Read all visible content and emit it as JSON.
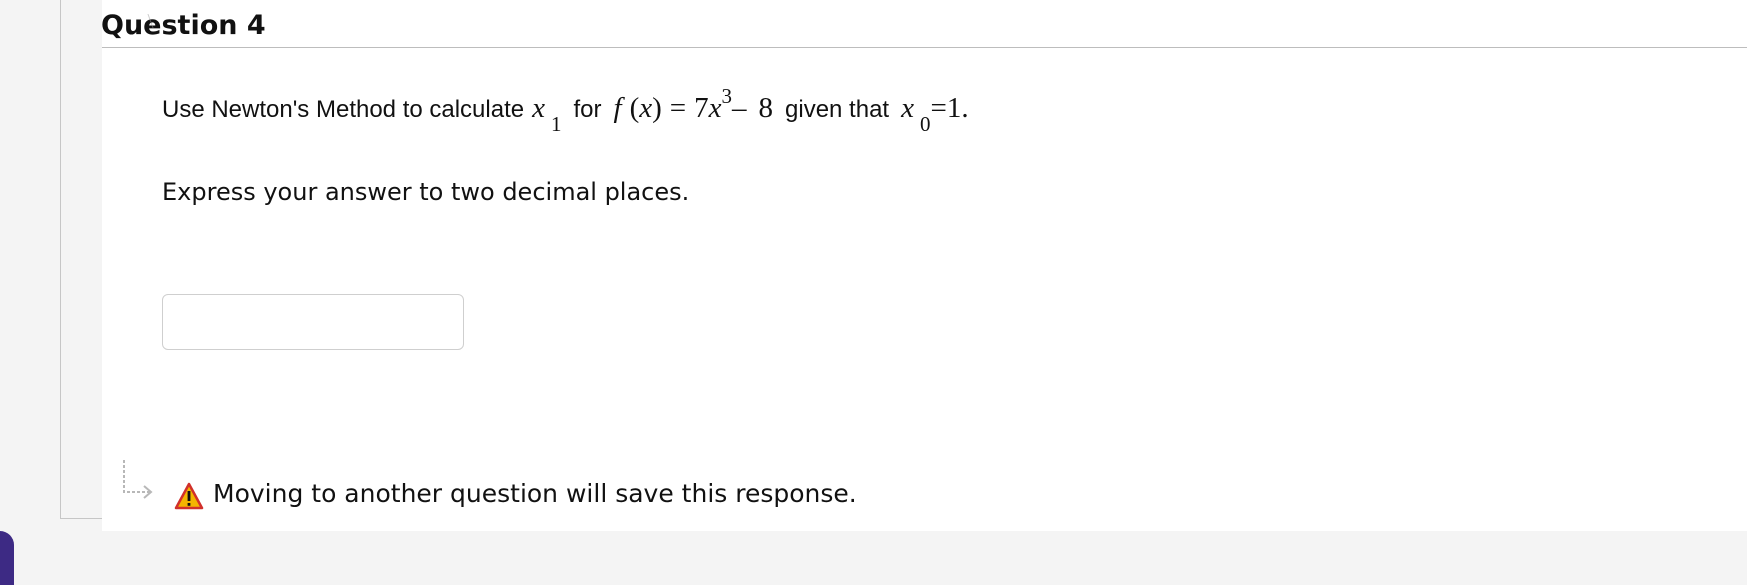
{
  "question": {
    "title": "Question 4"
  },
  "prompt": {
    "lead_text": "Use Newton's Method to calculate",
    "var_x": "x",
    "var_x_sub": "1",
    "for_text": "for",
    "f_name": "f",
    "f_arg_open": "(",
    "f_arg": "x",
    "f_arg_close": ")",
    "equals": "=",
    "coefficient": "7",
    "poly_var": "x",
    "exponent": "3",
    "minus": "–",
    "constant": "8",
    "given_text": "given that",
    "x0_var": "x",
    "x0_sub": "0",
    "x0_equals": "=",
    "x0_value": "1."
  },
  "instruction": {
    "text": "Express your answer to two decimal places."
  },
  "answer": {
    "value": "",
    "placeholder": ""
  },
  "notice": {
    "text": "Moving to another question will save this response."
  },
  "icons": {
    "arrow": "arrow-return-icon",
    "warning": "warning-icon"
  },
  "colors": {
    "warning_fill": "#f4b400",
    "warning_stroke": "#d1302b",
    "bottom_accent": "#3d2a84"
  }
}
